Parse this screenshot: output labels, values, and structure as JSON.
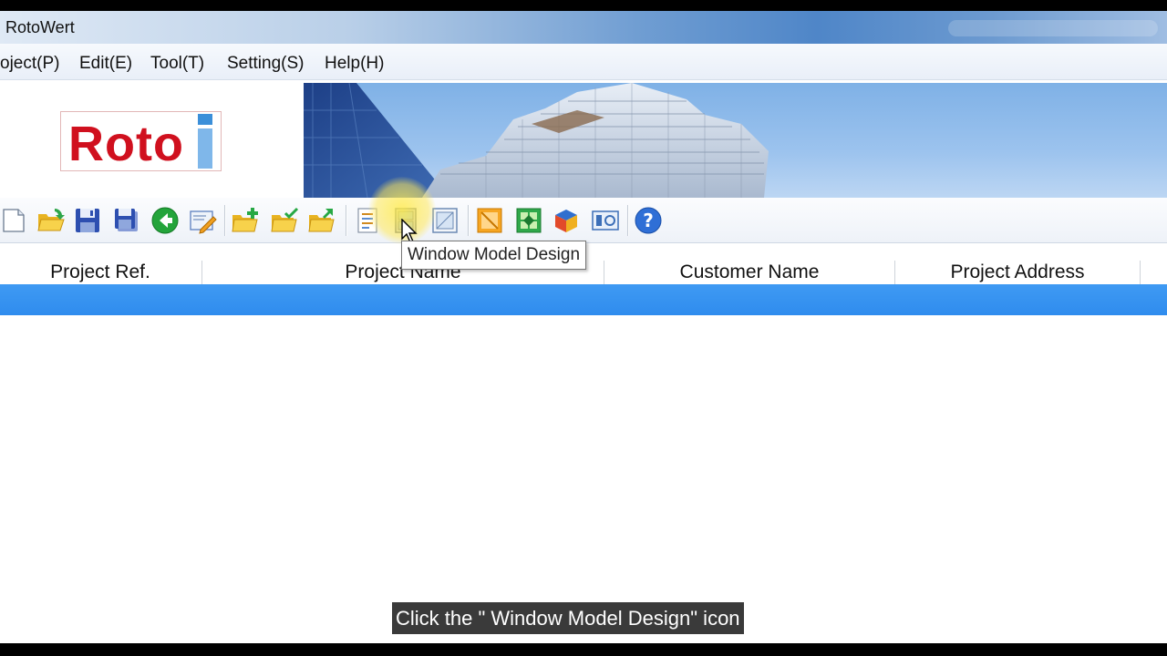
{
  "window": {
    "title": "RotoWert"
  },
  "menu": {
    "items": [
      "oject(P)",
      "Edit(E)",
      "Tool(T)",
      "Setting(S)",
      "Help(H)"
    ]
  },
  "logo": {
    "text": "Roto"
  },
  "toolbar": {
    "buttons": [
      {
        "icon": "new-document-icon"
      },
      {
        "icon": "open-folder-icon"
      },
      {
        "icon": "save-icon"
      },
      {
        "icon": "save-all-icon"
      },
      {
        "icon": "back-arrow-icon"
      },
      {
        "icon": "edit-icon"
      },
      {
        "icon": "new-folder-icon"
      },
      {
        "icon": "folder-check-icon"
      },
      {
        "icon": "folder-arrow-icon"
      },
      {
        "icon": "list-report-icon"
      },
      {
        "icon": "window-model-design-icon"
      },
      {
        "icon": "window-frame-icon"
      },
      {
        "icon": "profile-icon"
      },
      {
        "icon": "green-grid-icon"
      },
      {
        "icon": "color-cube-icon"
      },
      {
        "icon": "settings-panel-icon"
      },
      {
        "icon": "help-icon"
      }
    ]
  },
  "tooltip": {
    "text": "Window Model Design"
  },
  "table": {
    "columns": [
      "Project Ref.",
      "Project Name",
      "Customer Name",
      "Project Address"
    ]
  },
  "caption": {
    "text": "Click the \" Window Model Design\" icon"
  },
  "colors": {
    "selection_row": "#2f8cee",
    "logo_red": "#d0101e",
    "logo_blue": "#3b8fd9"
  }
}
